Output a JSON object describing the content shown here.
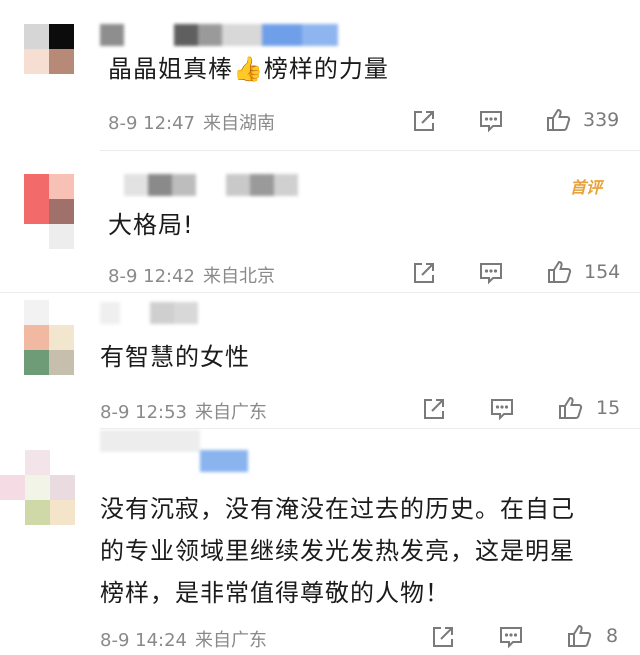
{
  "comments": [
    {
      "text": "晶晶姐真棒👍榜样的力量",
      "time": "8-9 12:47",
      "location": "来自湖南",
      "likes": "339",
      "avatar_colors": [
        "#d6d6d6",
        "#0c0c0c",
        "#f6dfd2",
        "#b78a78"
      ],
      "name_colors": [
        "#8e8e8e",
        "#ffffff",
        "#5f5f5f",
        "#9a9a9a",
        "#d8d8d8",
        "#6f9fe8",
        "#8fb5f0"
      ]
    },
    {
      "text": "大格局!",
      "time": "8-9 12:42",
      "location": "来自北京",
      "likes": "154",
      "badge": "首评",
      "avatar_colors": [
        "#f26a6a",
        "#f7c2b5",
        "#ffffff",
        "#a0706a",
        "#ffffff",
        "#ededed"
      ],
      "name_colors": [
        "#e2e2e2",
        "#8a8a8a",
        "#bdbdbd",
        "#ffffff",
        "#c9c9c9",
        "#9a9a9a",
        "#d0d0d0"
      ]
    },
    {
      "text": "有智慧的女性",
      "time": "8-9 12:53",
      "location": "来自广东",
      "likes": "15",
      "avatar_colors": [
        "#f2f2f2",
        "#ffffff",
        "#f1b9a2",
        "#f3e6cf",
        "#6e9c77",
        "#c7bfad"
      ],
      "name_colors": [
        "#efefef",
        "#ffffff",
        "#cfcfcf",
        "#ffffff",
        "#ffffff",
        "#ffffff",
        "#ffffff"
      ]
    },
    {
      "text": "没有沉寂，没有淹没在过去的历史。在自己\n的专业领域里继续发光发热发亮，这是明星\n榜样，是非常值得尊敬的人物！",
      "time": "8-9 14:24",
      "location": "来自广东",
      "likes": "8",
      "avatar_colors": [
        "#f3e4ea",
        "#ffffff",
        "#e9dbe0",
        "#f2f4e8",
        "#cfd9a8",
        "#f4e4c9"
      ],
      "name_colors": [
        "#eaeaea",
        "#eaeaea",
        "#eaeaea",
        "#eaeaea",
        "#ffffff",
        "#8ab4ee",
        "#ffffff"
      ]
    }
  ]
}
